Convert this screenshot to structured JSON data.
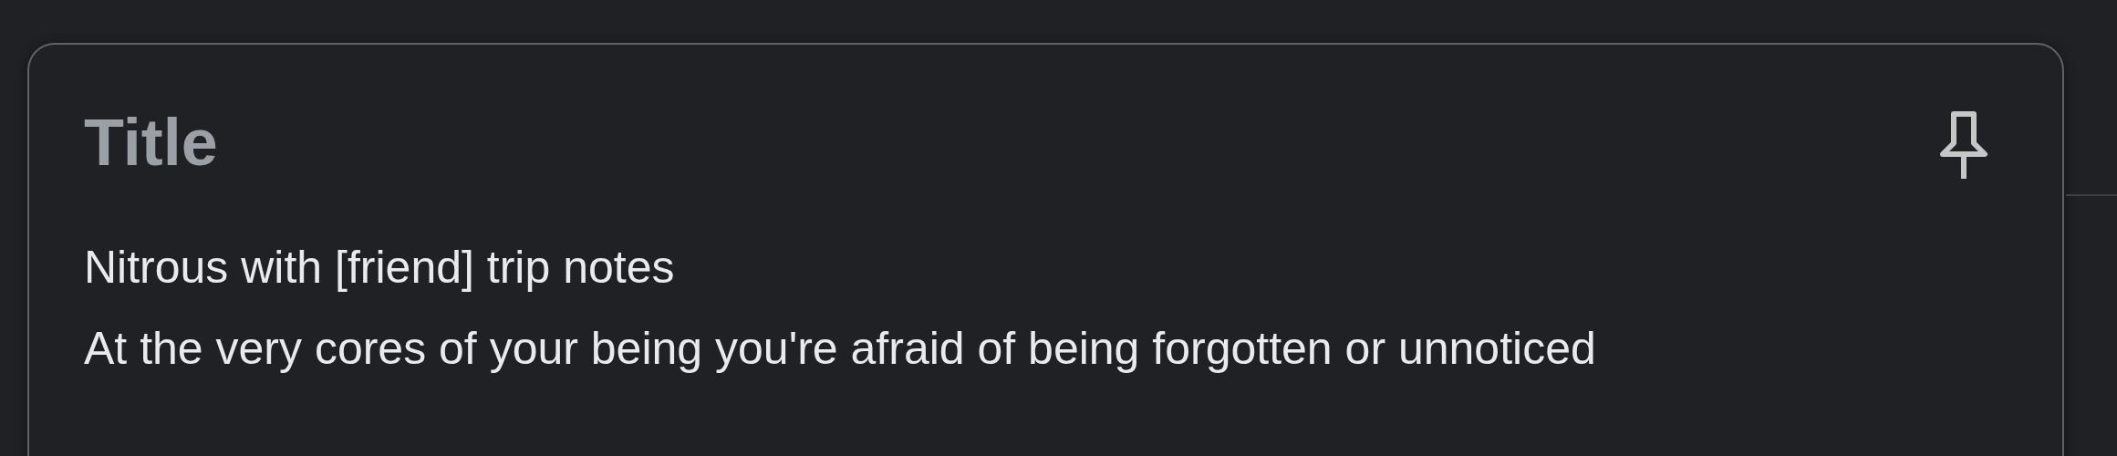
{
  "note": {
    "title_field": {
      "placeholder": "Title"
    },
    "pin": {
      "pinned": false
    },
    "body_lines": [
      "Nitrous with [friend] trip notes",
      "At the very cores of your being you're afraid of being forgotten or unnoticed"
    ]
  }
}
